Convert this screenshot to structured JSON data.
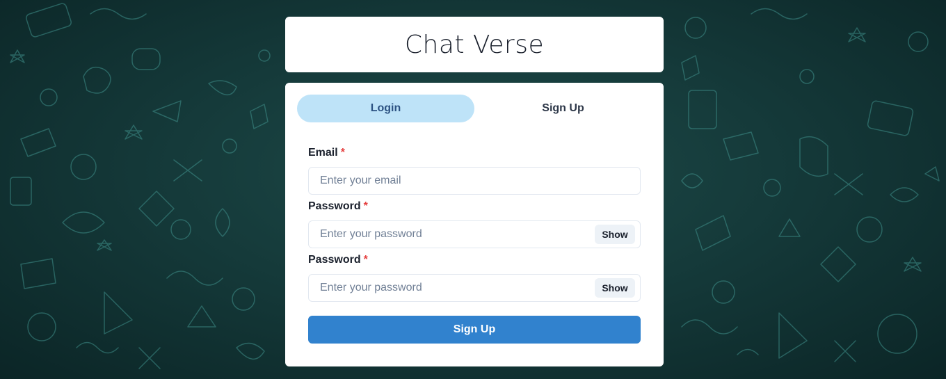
{
  "app": {
    "title": "Chat Verse"
  },
  "tabs": [
    {
      "label": "Login",
      "active": true
    },
    {
      "label": "Sign Up",
      "active": false
    }
  ],
  "form": {
    "required_marker": "*",
    "email": {
      "label": "Email",
      "value": "",
      "placeholder": "Enter your email"
    },
    "password": {
      "label": "Password",
      "value": "",
      "placeholder": "Enter your password",
      "toggle_label": "Show"
    },
    "confirm_password": {
      "label": "Password",
      "value": "",
      "placeholder": "Enter your password",
      "toggle_label": "Show"
    },
    "submit_label": "Sign Up"
  },
  "colors": {
    "background": "#153a3a",
    "active_tab": "#bee3f8",
    "primary_button": "#3182ce",
    "required": "#e53e3e"
  }
}
